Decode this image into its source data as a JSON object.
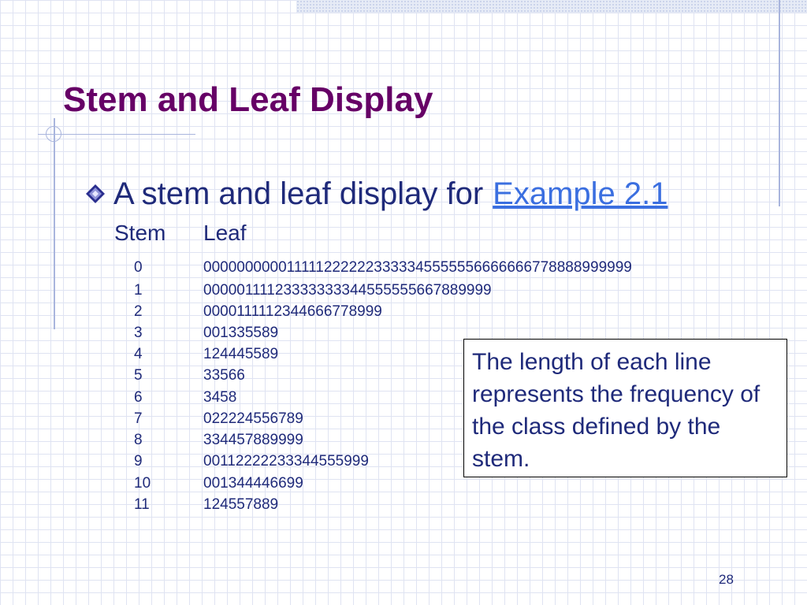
{
  "slide": {
    "title": "Stem and Leaf Display",
    "bullet": {
      "text": "A stem and leaf display for",
      "link": "Example 2.1"
    },
    "table": {
      "header_stem": "Stem",
      "header_leaf": "Leaf",
      "rows": [
        {
          "stem": "0",
          "leaf": "0000000000111112222223333345555556666666778888999999"
        },
        {
          "stem": "1",
          "leaf": "00000111123333333344555555667889999"
        },
        {
          "stem": "2",
          "leaf": "0000111112344666778999"
        },
        {
          "stem": "3",
          "leaf": "001335589"
        },
        {
          "stem": "4",
          "leaf": "124445589"
        },
        {
          "stem": "5",
          "leaf": "33566"
        },
        {
          "stem": "6",
          "leaf": "3458"
        },
        {
          "stem": "7",
          "leaf": "022224556789"
        },
        {
          "stem": "8",
          "leaf": "334457889999"
        },
        {
          "stem": "9",
          "leaf": "00112222233344555999"
        },
        {
          "stem": "10",
          "leaf": "001344446699"
        },
        {
          "stem": "11",
          "leaf": "124557889"
        }
      ]
    },
    "note": "The length of each line represents the frequency of the class defined by the stem.",
    "page_number": "28"
  },
  "colors": {
    "title": "#660066",
    "text": "#1f2a7a",
    "link": "#3b6fe0",
    "accent_lines": "#a9b5dd"
  },
  "icons": {
    "bullet": "diamond-bullet-icon"
  }
}
